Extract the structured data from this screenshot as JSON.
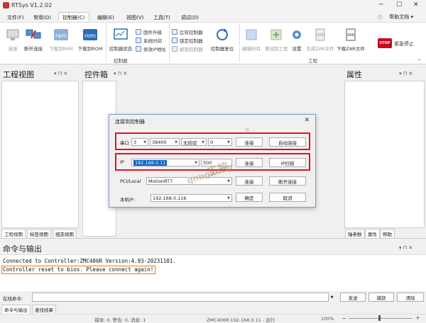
{
  "window": {
    "title": "RTSys V1.2.02",
    "controls": [
      "─",
      "☐",
      "✕"
    ]
  },
  "menu": {
    "items": [
      "文件(F)",
      "常用(O)",
      "控制器(C)",
      "编辑(E)",
      "视图(V)",
      "工具(T)",
      "调试(D)"
    ],
    "active_index": 2,
    "help": "帮助文档"
  },
  "ribbon": {
    "connect": "连接",
    "disconnect": "断开连接",
    "download_ram": "下载到RAM",
    "download_rom": "下载到ROM",
    "controller_status": "控制器状态",
    "firmware": "固件升级",
    "sys_time": "系统时间",
    "modify_ip": "修改IP地址",
    "compare": "比较控制器",
    "lock": "锁定控制器",
    "unlock": "解锁控制器",
    "reset": "控制器复位",
    "edit_all": "编辑所有",
    "add_to_project": "增加到工程",
    "settings": "设置",
    "gen_zar": "生成ZAR文件",
    "download_zar": "下载ZAR文件",
    "estop": "紧急停止",
    "estop_icon": "STOP",
    "group_controller": "控制器",
    "group_project": "工程"
  },
  "panels": {
    "project_view": "工程视图",
    "toolbox": "控件箱",
    "properties": "属性",
    "pin": "▾ ⊓ ✕",
    "left_tabs": [
      "工程视图",
      "标签视图",
      "组态视图"
    ],
    "right_tabs": [
      "轴参数",
      "属性",
      "帮助"
    ]
  },
  "dialog": {
    "title": "连接到控制器",
    "close": "✕",
    "serial": {
      "label": "串口",
      "port": "3",
      "baud": "38400",
      "parity": "无校验",
      "stop": "0",
      "connect": "连接",
      "auto_connect": "自动连接"
    },
    "ip": {
      "label": "IP",
      "value": "192.168.0.11",
      "port": "500",
      "connect": "连接",
      "scan": "IP扫描"
    },
    "pci": {
      "label": "PCI/Local",
      "value": "MotionRT7",
      "connect": "连接",
      "disconnect": "断开连接"
    },
    "local_ip": {
      "label": "本机IP:",
      "value": "192.168.0.116",
      "ok": "确定",
      "cancel": "取消"
    }
  },
  "command": {
    "title": "命令与输出",
    "log": [
      "Connected to Controller:ZMC406R Version:4.93-20231101.",
      "Controller reset to bios. Please connect again!"
    ],
    "input_label": "在线命令:",
    "input_value": "",
    "send": "发送",
    "capture": "捕获",
    "clear": "清除",
    "tabs": [
      "命令与输出",
      "查找结果"
    ]
  },
  "status": {
    "counts": "错误: 0, 警告: 0, 消息: 1",
    "controller": "ZMC406R:192.168.0.11 - 运行",
    "zoom": "100%"
  },
  "watermark": {
    "line1": "工控",
    "line2": "gongkong",
    "mark": "®"
  }
}
